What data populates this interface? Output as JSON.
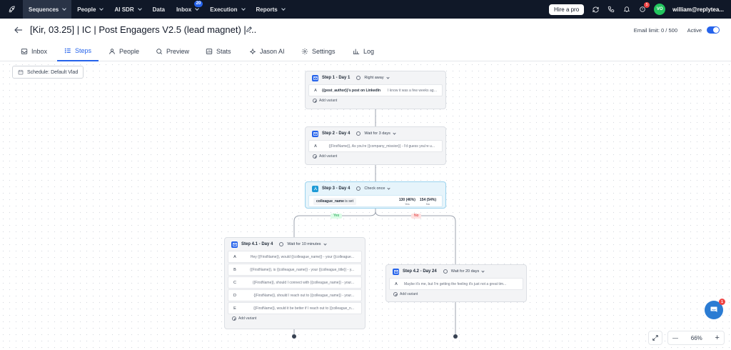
{
  "nav": {
    "items": [
      {
        "label": "Sequences",
        "active": true
      },
      {
        "label": "People"
      },
      {
        "label": "AI SDR"
      },
      {
        "label": "Data"
      },
      {
        "label": "Inbox",
        "badge": "20"
      },
      {
        "label": "Execution"
      },
      {
        "label": "Reports"
      }
    ],
    "hire_label": "Hire a pro",
    "notifications_count": "5",
    "avatar_initials": "VO",
    "user_email": "william@replytea..."
  },
  "header": {
    "title": "[Kir, 03.25] | IC | Post Engagers V2.5 (lead magnet) | ...",
    "email_limit": "Email limit:  0 / 500",
    "active_label": "Active"
  },
  "tabs": [
    {
      "label": "Inbox",
      "icon": "inbox-icon"
    },
    {
      "label": "Steps",
      "icon": "list-icon",
      "active": true
    },
    {
      "label": "People",
      "icon": "people-icon"
    },
    {
      "label": "Preview",
      "icon": "search-icon"
    },
    {
      "label": "Stats",
      "icon": "stats-icon"
    },
    {
      "label": "Jason AI",
      "icon": "ai-icon"
    },
    {
      "label": "Settings",
      "icon": "gear-icon"
    },
    {
      "label": "Log",
      "icon": "chart-icon"
    }
  ],
  "canvas": {
    "schedule_label": "Schedule: Default Vlad",
    "add_variant_label": "Add variant",
    "steps": {
      "step1": {
        "name": "Step 1 - Day 1",
        "wait": "Right away",
        "variants": [
          {
            "letter": "A",
            "subject": "{{post_author}}'s post on LinkedIn",
            "body": "I know it was a few weeks ago, {{Fi..."
          }
        ]
      },
      "step2": {
        "name": "Step 2 - Day 4",
        "wait": "Wait for 3 days",
        "variants": [
          {
            "letter": "A",
            "body": "{{FirstName}},  As you're {{company_mission}} - I'd guess you're u..."
          }
        ]
      },
      "step3": {
        "name": "Step 3 - Day 4",
        "wait": "Check once",
        "condition": "colleague_name",
        "condition_op": "is set",
        "yes_count": "130 (46%)",
        "yes_label": "Yes",
        "no_count": "154 (54%)",
        "no_label": "No"
      },
      "step41": {
        "name": "Step 4.1 - Day 4",
        "wait": "Wait for 10 minutes",
        "variants": [
          {
            "letter": "A",
            "body": "Hey {{FirstName}}, would {{colleague_name}} - your {{colleague..."
          },
          {
            "letter": "B",
            "body": "{{FirstName}}, is {{colleague_name}} - your {{colleague_title}} - y..."
          },
          {
            "letter": "C",
            "body": "{{FirstName}}, should I connect with {{colleague_name}} - your..."
          },
          {
            "letter": "D",
            "body": "{{FirstName}}, should I reach out to {{colleague_name}} - your..."
          },
          {
            "letter": "E",
            "body": "{{FirstName}}, would it be better if I reach out to {{colleague_n..."
          }
        ]
      },
      "step42": {
        "name": "Step 4.2 - Day 24",
        "wait": "Wait for 20 days",
        "variants": [
          {
            "letter": "A",
            "body": "Maybe it's me, but I'm getting the feeling it's just not a great tim..."
          }
        ]
      }
    },
    "branch_yes": "Yes",
    "branch_no": "No",
    "zoom_level": "66%",
    "zoom_minus": "—",
    "zoom_plus": "+",
    "chat_badge": "1"
  },
  "colors": {
    "nav_bg": "#101828",
    "accent": "#2563eb",
    "condition_bg": "#e6f4fb",
    "yes": "#16a34a",
    "no": "#dc2626"
  }
}
